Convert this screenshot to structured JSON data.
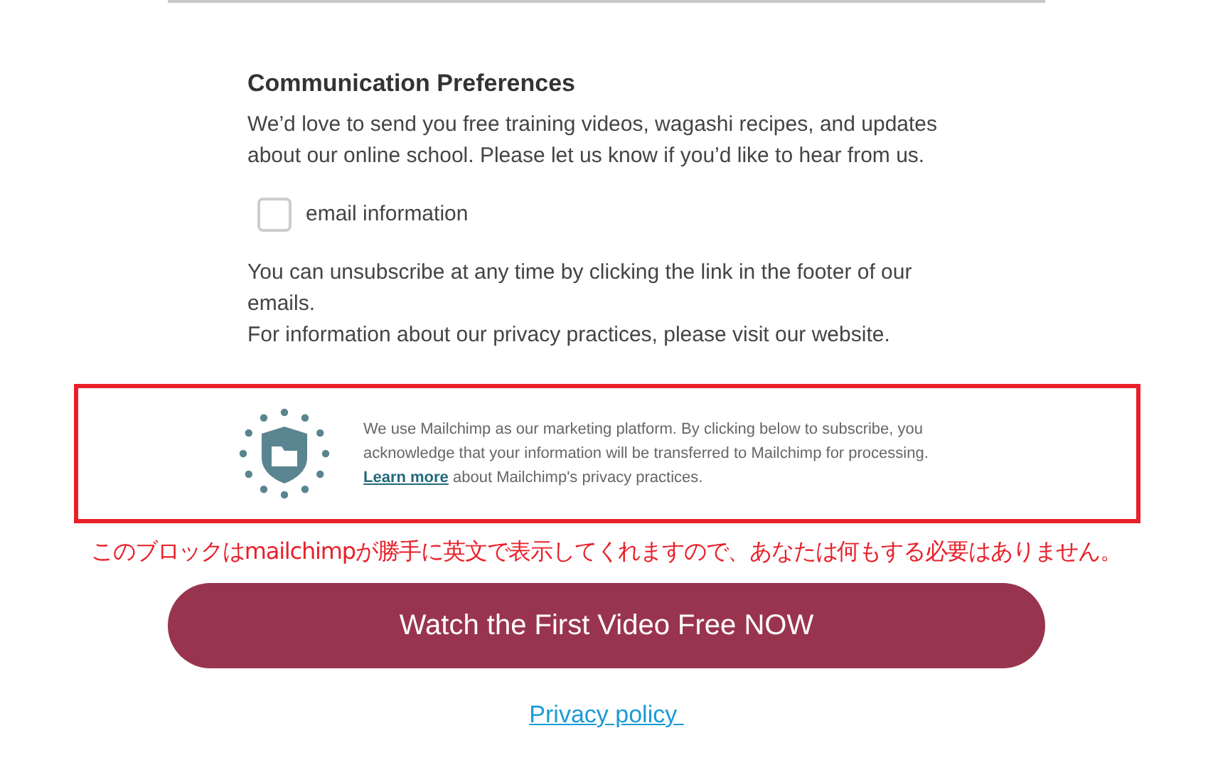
{
  "preferences": {
    "title": "Communication Preferences",
    "intro": "We’d love to send you free training videos, wagashi recipes, and updates about our online school. Please let us know if you’d like to hear from us.",
    "options": [
      {
        "label": "email information",
        "checked": false
      }
    ],
    "footer_lines": [
      "You can unsubscribe at any time by clicking the link in the footer of our emails.",
      "For information about our privacy practices, please visit our website."
    ]
  },
  "notice": {
    "text": "We use Mailchimp as our marketing platform. By clicking below to subscribe, you acknowledge that your information will be transferred to Mailchimp for processing.",
    "link": "Learn more",
    "text_after": "about Mailchimp's privacy practices."
  },
  "annotation": "このブロックはmailchimpが勝手に英文で表示してくれますので、あなたは何もする必要はありません。",
  "submit_button": "Watch the First Video Free NOW",
  "privacy_link": "Privacy policy "
}
